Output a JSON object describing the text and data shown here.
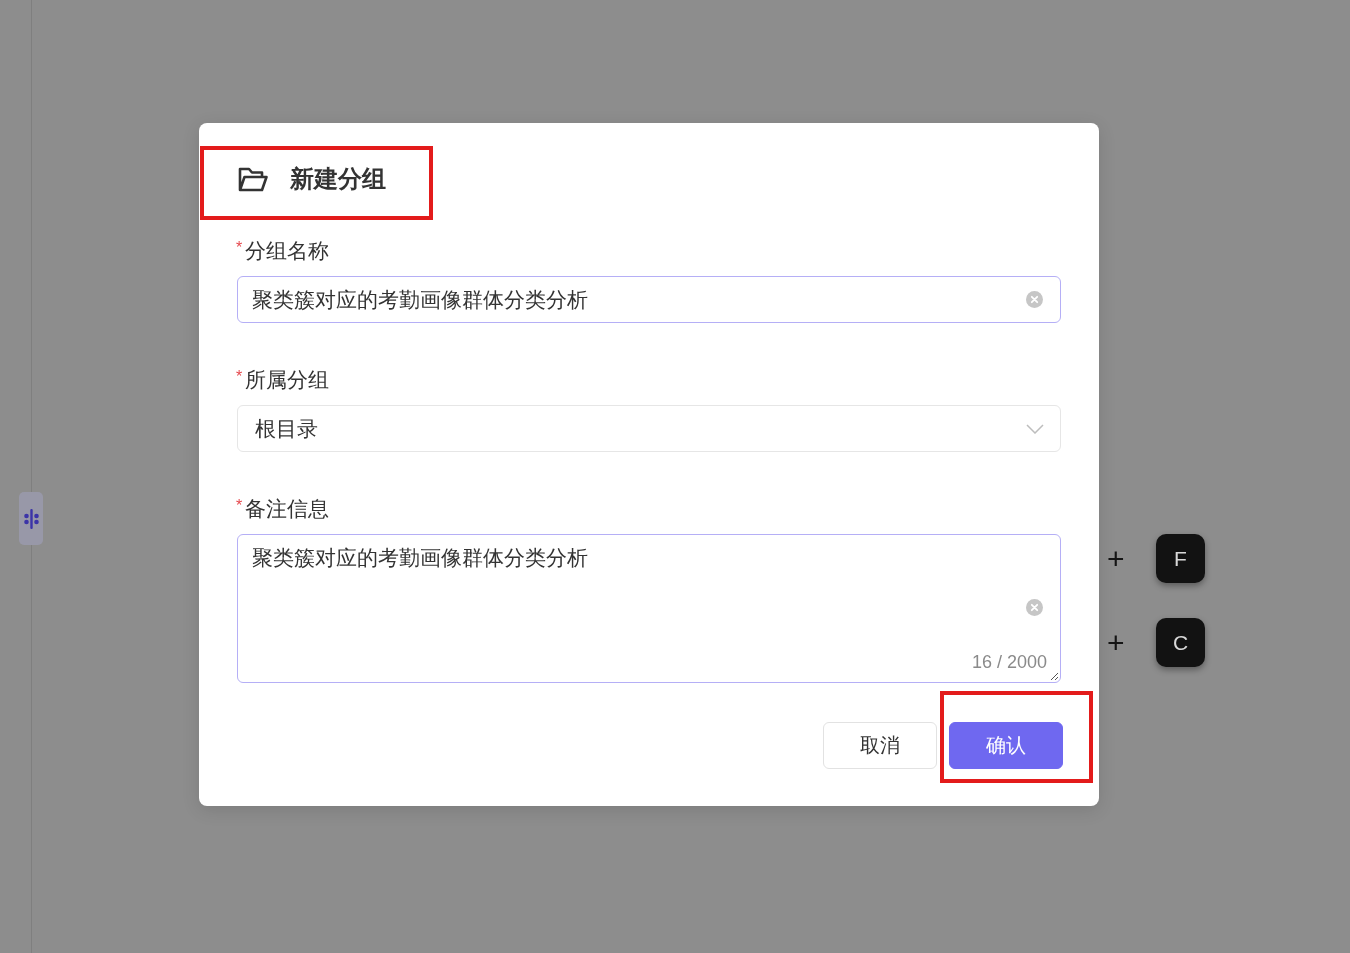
{
  "dialog": {
    "title": "新建分组",
    "title_highlighted": true,
    "fields": [
      {
        "kind": "input",
        "required_mark": "*",
        "label": "分组名称",
        "value": "聚类簇对应的考勤画像群体分类分析",
        "focused": true
      },
      {
        "kind": "select",
        "required_mark": "*",
        "label": "所属分组",
        "value": "根目录",
        "focused": false
      },
      {
        "kind": "textarea",
        "required_mark": "*",
        "label": "备注信息",
        "value": "聚类簇对应的考勤画像群体分类分析",
        "focused": true,
        "counter": "16 / 2000"
      }
    ],
    "buttons": [
      {
        "kind": "secondary",
        "label": "取消",
        "highlighted": false
      },
      {
        "kind": "primary",
        "label": "确认",
        "highlighted": true
      }
    ]
  },
  "shortcut_keys": [
    {
      "plus": "+",
      "key": "F"
    },
    {
      "plus": "+",
      "key": "C"
    }
  ]
}
